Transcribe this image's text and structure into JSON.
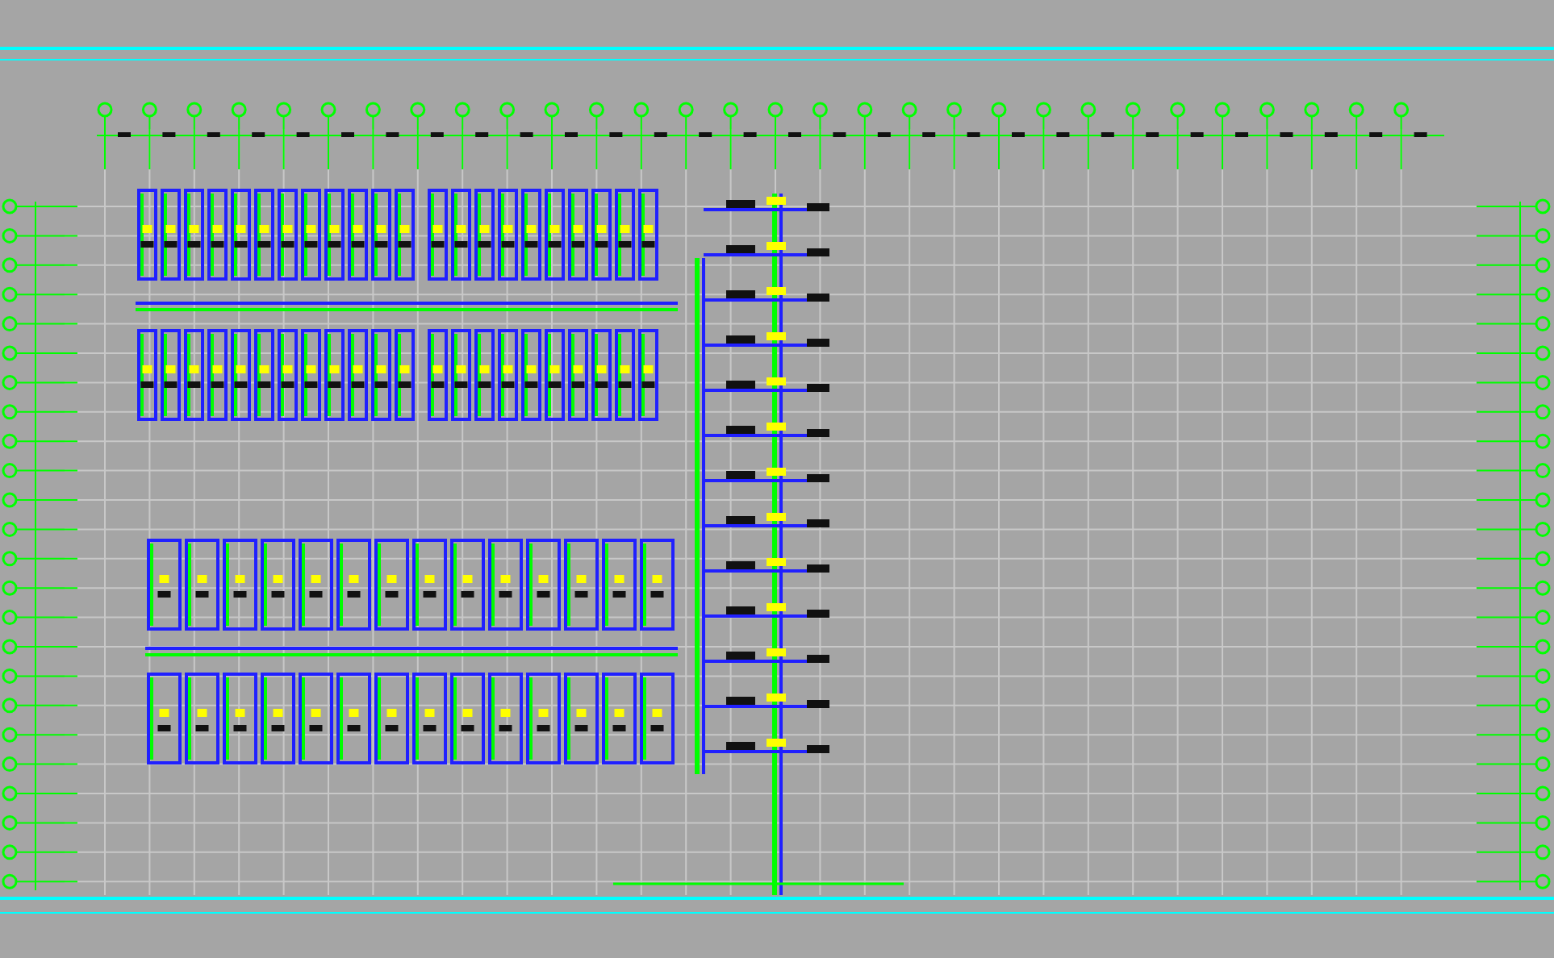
{
  "drawing": {
    "kind": "pipe-layout-plan"
  }
}
